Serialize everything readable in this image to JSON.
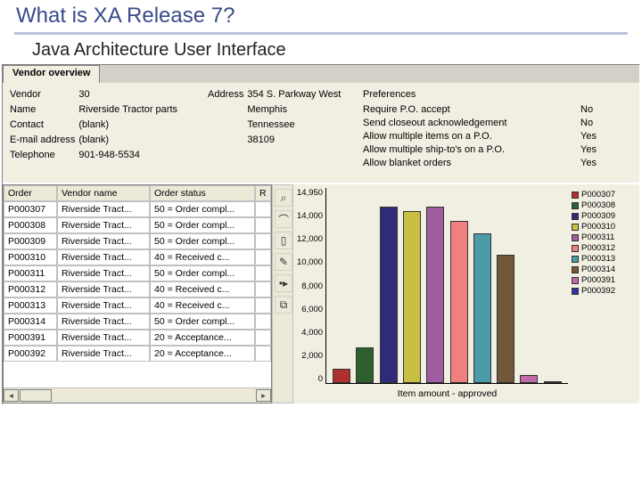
{
  "slide": {
    "title": "What is XA Release 7?",
    "subtitle": "Java Architecture User Interface"
  },
  "tab_label": "Vendor overview",
  "overview": {
    "col1_labels": [
      "Vendor",
      "Name",
      "Contact",
      "E-mail address",
      "Telephone"
    ],
    "col1_values": [
      "30",
      "Riverside Tractor parts",
      "(blank)",
      "(blank)",
      "901-948-5534"
    ],
    "col2_label": "Address",
    "col2_values": [
      "354 S. Parkway West",
      "Memphis",
      "Tennessee",
      "38109"
    ],
    "col3_label": "Preferences",
    "col3_items": [
      "Require P.O. accept",
      "Send closeout acknowledgement",
      "Allow multiple items on a P.O.",
      "Allow multiple ship-to's on a P.O.",
      "Allow blanket orders"
    ],
    "col3_values": [
      "No",
      "No",
      "Yes",
      "Yes",
      "Yes"
    ]
  },
  "grid": {
    "headers": [
      "Order",
      "Vendor name",
      "Order status",
      "R"
    ],
    "rows": [
      {
        "order": "P000307",
        "vendor": "Riverside Tract...",
        "status": "50 = Order compl..."
      },
      {
        "order": "P000308",
        "vendor": "Riverside Tract...",
        "status": "50 = Order compl..."
      },
      {
        "order": "P000309",
        "vendor": "Riverside Tract...",
        "status": "50 = Order compl..."
      },
      {
        "order": "P000310",
        "vendor": "Riverside Tract...",
        "status": "40 = Received c..."
      },
      {
        "order": "P000311",
        "vendor": "Riverside Tract...",
        "status": "50 = Order compl..."
      },
      {
        "order": "P000312",
        "vendor": "Riverside Tract...",
        "status": "40 = Received c..."
      },
      {
        "order": "P000313",
        "vendor": "Riverside Tract...",
        "status": "40 = Received c..."
      },
      {
        "order": "P000314",
        "vendor": "Riverside Tract...",
        "status": "50 = Order compl..."
      },
      {
        "order": "P000391",
        "vendor": "Riverside Tract...",
        "status": "20 = Acceptance..."
      },
      {
        "order": "P000392",
        "vendor": "Riverside Tract...",
        "status": "20 = Acceptance..."
      }
    ]
  },
  "toolbar_icons": [
    "binoculars-icon",
    "glasses-icon",
    "doc-icon",
    "pencil-icon",
    "bullet-icon",
    "copy-icon"
  ],
  "toolbar_glyphs": [
    "⌕",
    "⌒",
    "▯",
    "✎",
    "•▸",
    "⧉"
  ],
  "chart_data": {
    "type": "bar",
    "title": "",
    "xlabel": "Item amount - approved",
    "ylabel": "",
    "ylim": [
      0,
      14950
    ],
    "y_ticks": [
      "14,950",
      "14,000",
      "12,000",
      "10,000",
      "8,000",
      "6,000",
      "4,000",
      "2,000",
      "0"
    ],
    "categories": [
      "P000307",
      "P000308",
      "P000309",
      "P000310",
      "P000311",
      "P000312",
      "P000313",
      "P000314",
      "P000391",
      "P000392"
    ],
    "values": [
      1100,
      2700,
      13500,
      13200,
      13500,
      12400,
      11500,
      9800,
      600,
      0
    ],
    "colors": [
      "#b03030",
      "#2e5f2e",
      "#302a7a",
      "#c8c040",
      "#a05ca0",
      "#f08080",
      "#4a9aa8",
      "#705838",
      "#c06aa8",
      "#3030a0"
    ]
  }
}
